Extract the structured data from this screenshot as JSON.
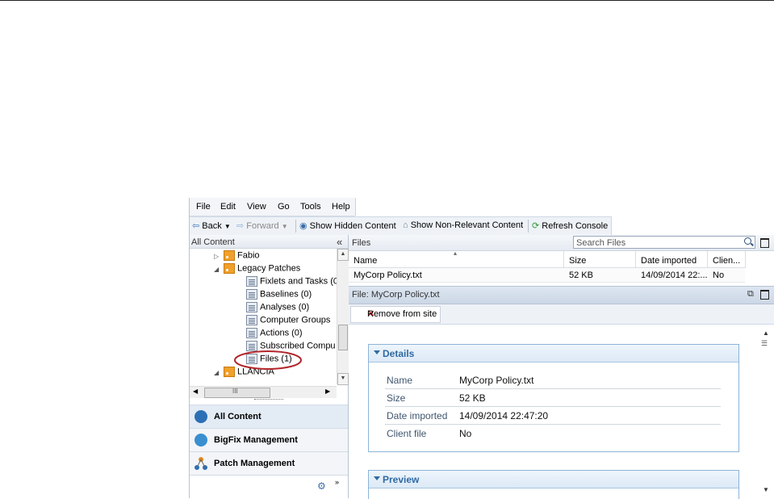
{
  "menu": [
    "File",
    "Edit",
    "View",
    "Go",
    "Tools",
    "Help"
  ],
  "toolbar": {
    "back": "Back",
    "forward": "Forward",
    "show_hidden": "Show Hidden Content",
    "show_non_relevant": "Show Non-Relevant Content",
    "refresh": "Refresh Console"
  },
  "left_pane": {
    "header": "All Content",
    "collapse_glyph": "«",
    "tree": [
      {
        "label": "Fabio",
        "icon": "rss-site-icon"
      },
      {
        "label": "Legacy Patches",
        "icon": "rss-site-icon"
      },
      {
        "label": "Fixlets and Tasks (0",
        "icon": "fixlets-icon"
      },
      {
        "label": "Baselines (0)",
        "icon": "baselines-icon"
      },
      {
        "label": "Analyses (0)",
        "icon": "analyses-icon"
      },
      {
        "label": "Computer Groups",
        "icon": "computer-groups-icon"
      },
      {
        "label": "Actions (0)",
        "icon": "actions-icon"
      },
      {
        "label": "Subscribed Compu",
        "icon": "subscribed-computers-icon"
      },
      {
        "label": "Files (1)",
        "icon": "files-icon"
      },
      {
        "label": "LLANCIA",
        "icon": "rss-site-icon"
      }
    ],
    "hscroll_grip": "III",
    "nav": [
      {
        "label": "All Content",
        "icon": "bigfix-logo-icon",
        "color": "#2d6fb5"
      },
      {
        "label": "BigFix Management",
        "icon": "globe-icon",
        "color": "#3a8fd0"
      },
      {
        "label": "Patch Management",
        "icon": "network-icon",
        "color": "#e6891e"
      }
    ]
  },
  "files_pane": {
    "title": "Files",
    "search_placeholder": "Search Files",
    "columns": [
      "Name",
      "Size",
      "Date imported",
      "Clien..."
    ],
    "rows": [
      {
        "name": "MyCorp Policy.txt",
        "size": "52 KB",
        "date": "14/09/2014 22:...",
        "client": "No"
      }
    ]
  },
  "file_detail": {
    "title": "File: MyCorp Policy.txt",
    "remove_button": "Remove from site",
    "details_header": "Details",
    "details": [
      {
        "key": "Name",
        "value": "MyCorp Policy.txt"
      },
      {
        "key": "Size",
        "value": "52 KB"
      },
      {
        "key": "Date imported",
        "value": "14/09/2014 22:47:20"
      },
      {
        "key": "Client file",
        "value": "No"
      }
    ],
    "preview_header": "Preview"
  },
  "colors": {
    "accent": "#2f6aa3",
    "highlight_circle": "#b3262a"
  }
}
